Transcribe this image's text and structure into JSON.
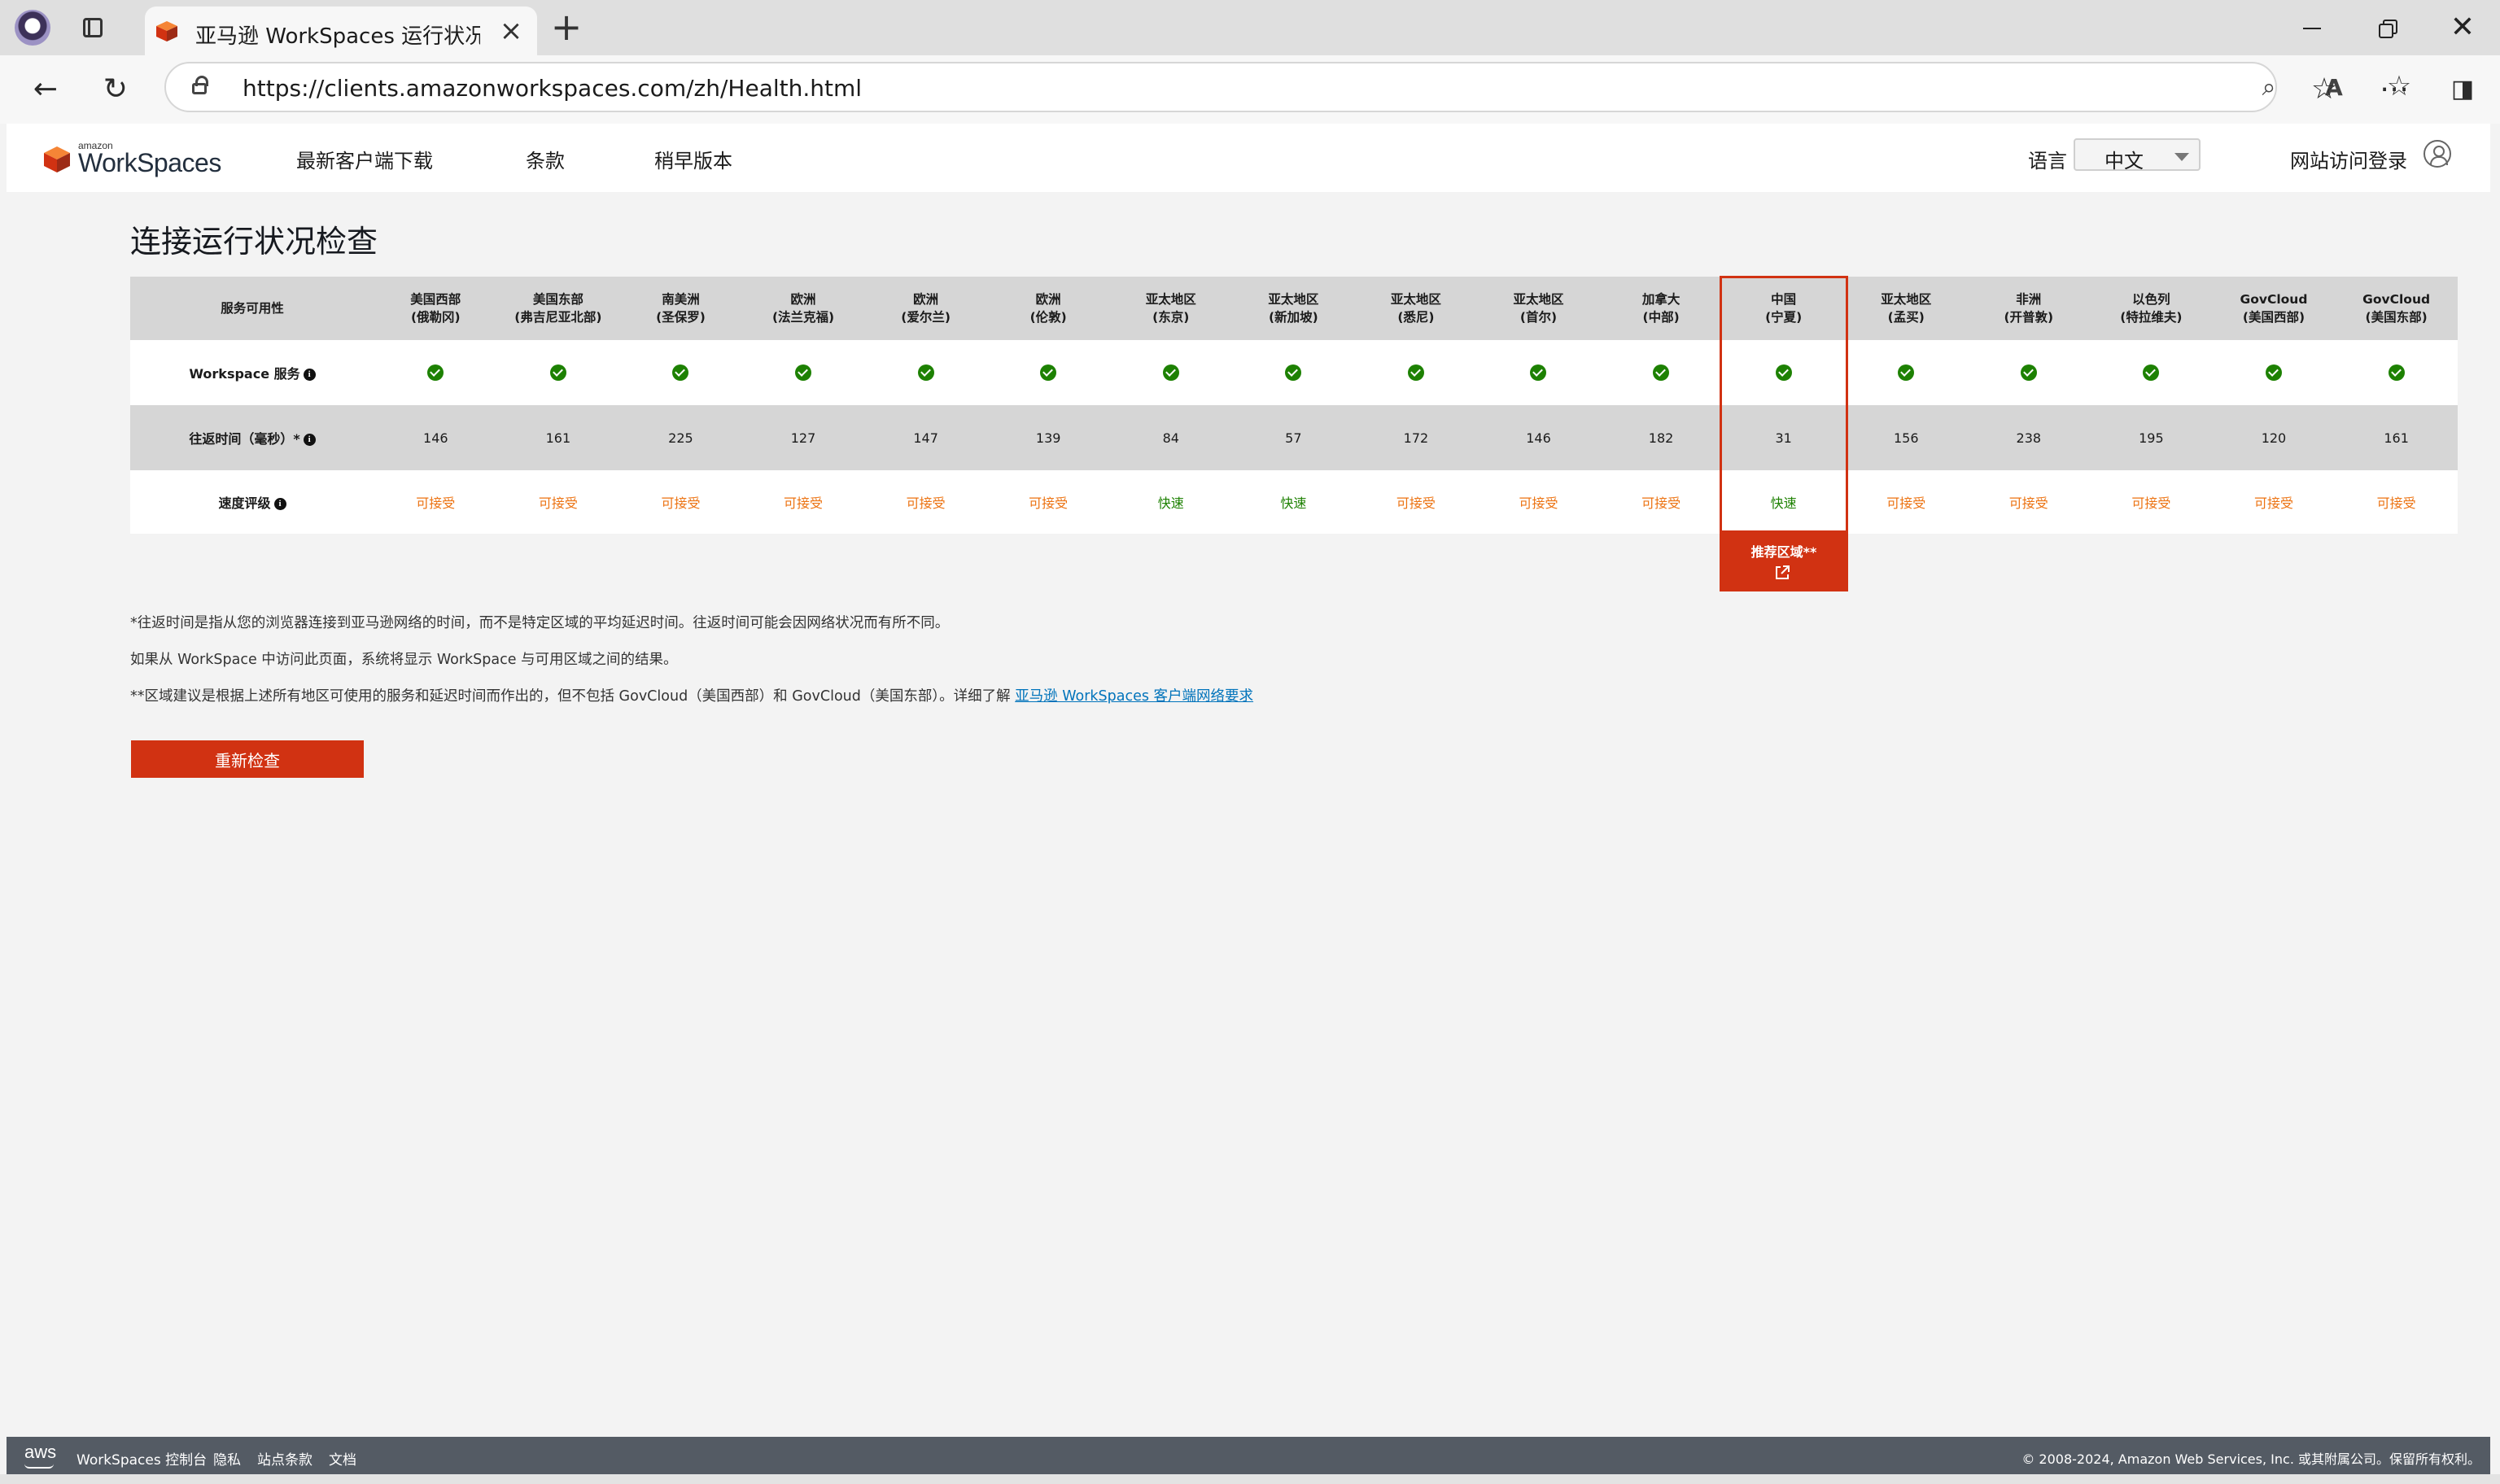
{
  "browser": {
    "tab_title": "亚马逊 WorkSpaces 运行状况控制",
    "url": "https://clients.amazonworkspaces.com/zh/Health.html"
  },
  "header": {
    "logo_small": "amazon",
    "logo_main": "WorkSpaces",
    "nav": [
      "最新客户端下载",
      "条款",
      "稍早版本"
    ],
    "language_label": "语言",
    "language_value": "中文",
    "signin": "网站访问登录"
  },
  "main": {
    "title": "连接运行状况检查",
    "row_labels": {
      "availability": "服务可用性",
      "service": "Workspace 服务",
      "rtt": "往返时间（毫秒）*",
      "speed": "速度评级"
    },
    "regions": [
      {
        "line1": "美国西部",
        "line2": "(俄勒冈)",
        "rtt": "146",
        "speed": "可接受",
        "fast": false
      },
      {
        "line1": "美国东部",
        "line2": "(弗吉尼亚北部)",
        "rtt": "161",
        "speed": "可接受",
        "fast": false
      },
      {
        "line1": "南美洲",
        "line2": "(圣保罗)",
        "rtt": "225",
        "speed": "可接受",
        "fast": false
      },
      {
        "line1": "欧洲",
        "line2": "(法兰克福)",
        "rtt": "127",
        "speed": "可接受",
        "fast": false
      },
      {
        "line1": "欧洲",
        "line2": "(爱尔兰)",
        "rtt": "147",
        "speed": "可接受",
        "fast": false
      },
      {
        "line1": "欧洲",
        "line2": "(伦敦)",
        "rtt": "139",
        "speed": "可接受",
        "fast": false
      },
      {
        "line1": "亚太地区",
        "line2": "(东京)",
        "rtt": "84",
        "speed": "快速",
        "fast": true
      },
      {
        "line1": "亚太地区",
        "line2": "(新加坡)",
        "rtt": "57",
        "speed": "快速",
        "fast": true
      },
      {
        "line1": "亚太地区",
        "line2": "(悉尼)",
        "rtt": "172",
        "speed": "可接受",
        "fast": false
      },
      {
        "line1": "亚太地区",
        "line2": "(首尔)",
        "rtt": "146",
        "speed": "可接受",
        "fast": false
      },
      {
        "line1": "加拿大",
        "line2": "(中部)",
        "rtt": "182",
        "speed": "可接受",
        "fast": false
      },
      {
        "line1": "中国",
        "line2": "(宁夏)",
        "rtt": "31",
        "speed": "快速",
        "fast": true
      },
      {
        "line1": "亚太地区",
        "line2": "(孟买)",
        "rtt": "156",
        "speed": "可接受",
        "fast": false
      },
      {
        "line1": "非洲",
        "line2": "(开普敦)",
        "rtt": "238",
        "speed": "可接受",
        "fast": false
      },
      {
        "line1": "以色列",
        "line2": "(特拉维夫)",
        "rtt": "195",
        "speed": "可接受",
        "fast": false
      },
      {
        "line1": "GovCloud",
        "line2": "(美国西部)",
        "rtt": "120",
        "speed": "可接受",
        "fast": false
      },
      {
        "line1": "GovCloud",
        "line2": "(美国东部)",
        "rtt": "161",
        "speed": "可接受",
        "fast": false
      }
    ],
    "recommended_label": "推荐区域**",
    "notes": [
      "*往返时间是指从您的浏览器连接到亚马逊网络的时间，而不是特定区域的平均延迟时间。往返时间可能会因网络状况而有所不同。",
      "如果从 WorkSpace 中访问此页面，系统将显示 WorkSpace 与可用区域之间的结果。",
      "**区域建议是根据上述所有地区可使用的服务和延迟时间而作出的，但不包括 GovCloud（美国西部）和 GovCloud（美国东部）。详细了解 "
    ],
    "notes_link": "亚马逊 WorkSpaces 客户端网络要求",
    "recheck_button": "重新检查"
  },
  "footer": {
    "logo": "aws",
    "links": [
      "WorkSpaces 控制台",
      "隐私",
      "站点条款",
      "文档"
    ],
    "copyright": "© 2008-2024, Amazon Web Services, Inc. 或其附属公司。保留所有权利。"
  },
  "colors": {
    "accent_red": "#d13212",
    "ok_green": "#1d8102",
    "acceptable_orange": "#ec7211",
    "footer_bg": "#545b64"
  }
}
